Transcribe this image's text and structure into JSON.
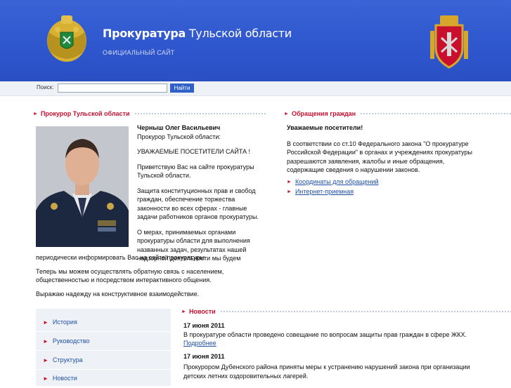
{
  "header": {
    "title_bold": "Прокуратура",
    "title_rest": "Тульской области",
    "subtitle": "ОФИЦИАЛЬНЫЙ САЙТ"
  },
  "search": {
    "label": "Поиск:",
    "value": "",
    "button": "Найти"
  },
  "prosecutor": {
    "heading": "Прокурор Тульской области",
    "name": "Черныш Олег Васильевич",
    "position": "Прокурор Тульской области:",
    "greeting": "УВАЖАЕМЫЕ ПОСЕТИТЕЛИ САЙТА !",
    "p1_lines": [
      "Приветствую Вас на сайте прокуратуры",
      "Тульской области."
    ],
    "p2_lines": [
      "Защита конституционных прав и свобод",
      "граждан, обеспечение торжества",
      "законности во всех сферах - главные",
      "задачи работников органов прокуратуры."
    ],
    "p3_lines": [
      "О мерах, принимаемых органами",
      "прокуратуры области для выполнения",
      "названных задач, результатах нашей",
      "надзорной деятельности мы будем"
    ],
    "p3_tail": "периодически информировать Вас на сайте прокуратуры.",
    "p4_lines": [
      "Теперь мы можем осуществлять обратную связь с населением,",
      "общественностью и посредством интерактивного общения."
    ],
    "p5": "Выражаю надежду на конструктивное взаимодействие."
  },
  "appeals": {
    "heading": "Обращения граждан",
    "greeting": "Уважаемые посетители!",
    "text_lines": [
      "В соответствии со ст.10 Федерального закона \"О прокуратуре",
      "Российской Федерации\" в органах и учреждениях прокуратуры",
      "разрешаются заявления, жалобы и иные обращения,",
      "содержащие сведения о нарушении законов."
    ],
    "links": [
      "Координаты для обращений",
      "Интернет-приемная"
    ]
  },
  "nav": {
    "items": [
      "История",
      "Руководство",
      "Структура",
      "Новости"
    ]
  },
  "news": {
    "heading": "Новости",
    "items": [
      {
        "date": "17 июня 2011",
        "text": "В прокуратуре области проведено совещание по вопросам защиты прав граждан в сфере ЖКХ.",
        "more": "Подробнее"
      },
      {
        "date": "17 июня 2011",
        "text_lines": [
          "Прокурором Дубенского района приняты меры к устранению нарушений закона при организации",
          "детских летних оздоровительных лагерей."
        ]
      }
    ]
  },
  "colors": {
    "header_blue": "#2f56cd",
    "accent_red": "#c8102e",
    "link_blue": "#1f4fa8",
    "nav_bg": "#eef1f6"
  }
}
